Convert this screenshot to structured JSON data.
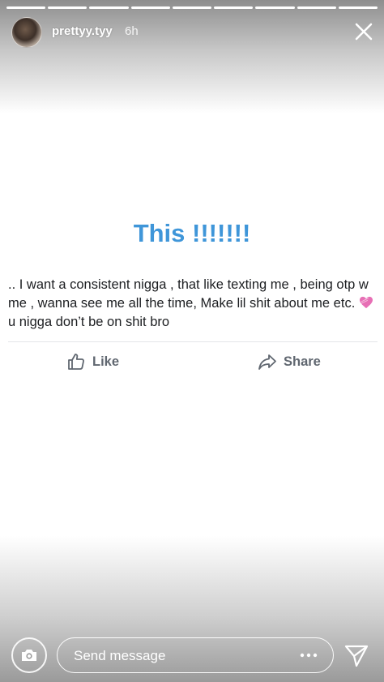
{
  "story": {
    "progress": [
      1.0,
      1.0,
      1.0,
      1.0,
      1.0,
      1.0,
      1.0,
      1.0,
      1.0
    ],
    "username": "prettyy.tyy",
    "time": "6h",
    "close_icon": "close-icon"
  },
  "post": {
    "headline": "This !!!!!!!",
    "text_part1": ".. I want a consistent nigga , that like texting me , being otp w me , wanna see me all the time,   Make lil shit about me etc. ",
    "emoji": "heart-emoji-icon",
    "text_part2": "u nigga don’t be on shit bro",
    "like_label": "Like",
    "share_label": "Share"
  },
  "footer": {
    "placeholder": "Send message",
    "camera_icon": "camera-icon",
    "more_icon": "more-dots-icon",
    "send_icon": "send-icon"
  },
  "colors": {
    "headline": "#3f96d9",
    "post_text": "#1c1e21",
    "action_text": "#606770"
  }
}
